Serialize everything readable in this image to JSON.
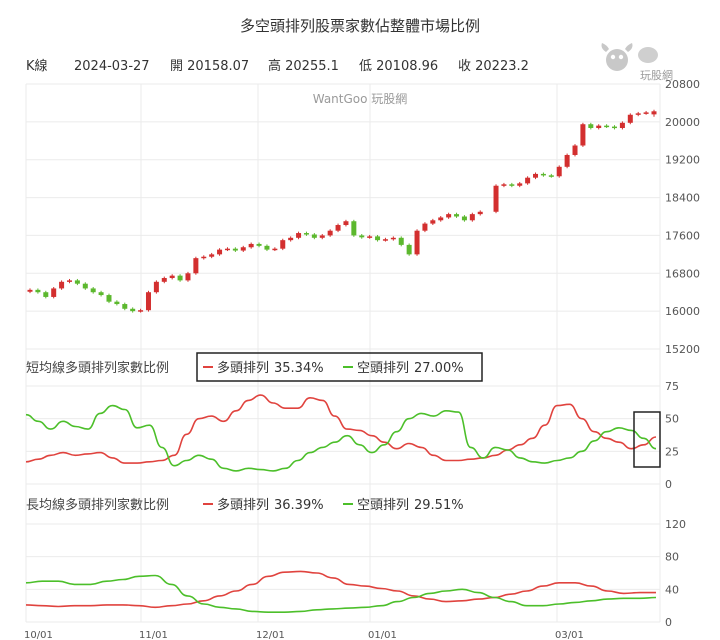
{
  "title": "多空頭排列股票家數佔整體市場比例",
  "info": {
    "label": "K線",
    "date": "2024-03-27",
    "open": "開 20158.07",
    "high": "高 20255.1",
    "low": "低 20108.96",
    "close": "收 20223.2"
  },
  "watermark": "WantGoo 玩股網",
  "logo_text": "玩股網",
  "colors": {
    "up": "#d32f2f",
    "down": "#5cb82e",
    "red_line": "#e0433e",
    "green_line": "#4cbf2a",
    "grid": "#ebebeb"
  },
  "chart_data": [
    {
      "type": "candlestick",
      "panel": "price",
      "ylim": [
        15200,
        20800
      ],
      "yticks": [
        "15200",
        "16000",
        "16800",
        "17600",
        "18400",
        "19200",
        "20000",
        "20800"
      ],
      "xticks": [
        "10/01",
        "11/01",
        "12/01",
        "01/01",
        "03/01"
      ],
      "close": [
        16450,
        16400,
        16300,
        16480,
        16620,
        16650,
        16580,
        16480,
        16400,
        16340,
        16200,
        16150,
        16050,
        16000,
        16020,
        16400,
        16620,
        16700,
        16750,
        16650,
        16800,
        17120,
        17150,
        17200,
        17300,
        17320,
        17280,
        17350,
        17420,
        17380,
        17300,
        17320,
        17500,
        17550,
        17650,
        17620,
        17550,
        17600,
        17700,
        17820,
        17900,
        17600,
        17560,
        17580,
        17500,
        17520,
        17550,
        17400,
        17200,
        17700,
        17850,
        17920,
        17980,
        18050,
        18000,
        17920,
        18050,
        18100,
        null,
        18650,
        18680,
        18650,
        18700,
        18820,
        18900,
        18870,
        18850,
        19050,
        19300,
        19500,
        19950,
        19870,
        19920,
        19900,
        19870,
        19980,
        20150,
        20180,
        20200,
        20223
      ],
      "current": {
        "date": "2024-03-27",
        "open": 20158.07,
        "high": 20255.1,
        "low": 20108.96,
        "close": 20223.2
      }
    },
    {
      "type": "line",
      "panel": "short",
      "title": "短均線多頭排列家數比例",
      "ylim": [
        0,
        75
      ],
      "yticks": [
        "0",
        "25",
        "50",
        "75"
      ],
      "legend": [
        {
          "name": "多頭排列",
          "value": "35.34%"
        },
        {
          "name": "空頭排列",
          "value": "27.00%"
        }
      ],
      "series": [
        {
          "name": "多頭排列",
          "values": [
            17,
            19,
            22,
            24,
            22,
            23,
            24,
            20,
            16,
            16,
            17,
            18,
            22,
            38,
            50,
            52,
            48,
            56,
            64,
            68,
            62,
            58,
            58,
            66,
            64,
            52,
            42,
            41,
            37,
            32,
            27,
            31,
            28,
            22,
            18,
            18,
            19,
            20,
            22,
            26,
            30,
            35,
            45,
            60,
            61,
            50,
            40,
            35,
            32,
            27,
            30,
            36
          ]
        },
        {
          "name": "空頭排列",
          "values": [
            53,
            48,
            42,
            48,
            44,
            42,
            54,
            60,
            57,
            43,
            45,
            28,
            14,
            18,
            22,
            19,
            12,
            10,
            12,
            11,
            10,
            12,
            18,
            24,
            28,
            32,
            37,
            30,
            24,
            30,
            40,
            50,
            54,
            52,
            56,
            55,
            28,
            20,
            28,
            26,
            20,
            17,
            16,
            18,
            20,
            25,
            33,
            40,
            43,
            41,
            35,
            27
          ]
        }
      ]
    },
    {
      "type": "line",
      "panel": "long",
      "title": "長均線多頭排列家數比例",
      "ylim": [
        0,
        120
      ],
      "yticks": [
        "0",
        "40",
        "80",
        "120"
      ],
      "legend": [
        {
          "name": "多頭排列",
          "value": "36.39%"
        },
        {
          "name": "空頭排列",
          "value": "29.51%"
        }
      ],
      "series": [
        {
          "name": "多頭排列",
          "values": [
            21,
            20,
            19,
            20,
            20,
            21,
            21,
            20,
            18,
            20,
            22,
            26,
            32,
            38,
            46,
            56,
            61,
            62,
            60,
            54,
            46,
            44,
            41,
            38,
            32,
            28,
            25,
            26,
            28,
            30,
            34,
            38,
            44,
            48,
            48,
            44,
            38,
            35,
            36,
            36
          ]
        },
        {
          "name": "空頭排列",
          "values": [
            48,
            50,
            50,
            46,
            46,
            50,
            52,
            56,
            57,
            46,
            32,
            22,
            18,
            16,
            13,
            12,
            12,
            13,
            15,
            16,
            17,
            18,
            20,
            25,
            30,
            35,
            38,
            40,
            36,
            30,
            25,
            20,
            20,
            22,
            24,
            26,
            28,
            29,
            29,
            30
          ]
        }
      ]
    }
  ]
}
